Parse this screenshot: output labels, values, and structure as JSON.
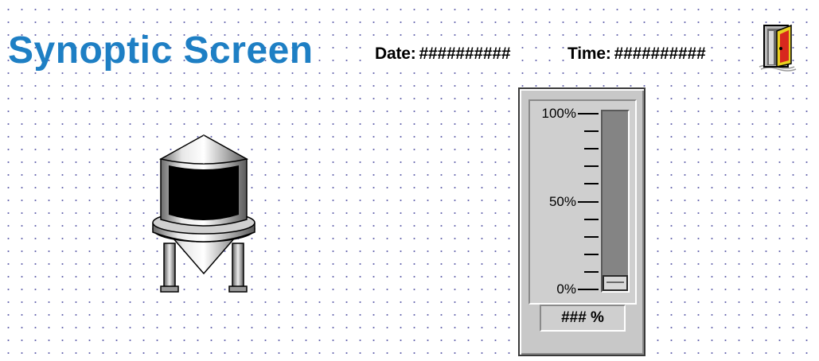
{
  "header": {
    "title": "Synoptic Screen",
    "date_label": "Date:",
    "date_value": "##########",
    "time_label": "Time:",
    "time_value": "##########",
    "exit_icon": "exit-door-icon"
  },
  "tank": {
    "icon": "storage-tank-icon"
  },
  "gauge": {
    "labels": {
      "max": "100%",
      "mid": "50%",
      "min": "0%"
    },
    "value_display": "### %",
    "level_fraction": 0
  },
  "colors": {
    "title": "#1e7fc4",
    "grid_dot": "#6a6ab0"
  }
}
